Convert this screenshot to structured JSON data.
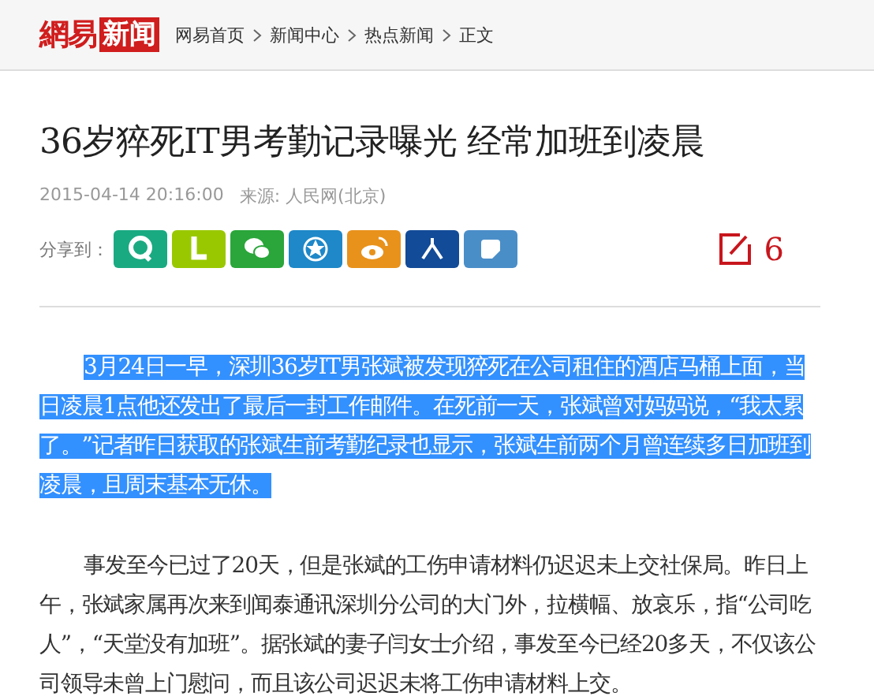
{
  "header": {
    "logo": {
      "text": "網易",
      "badge": "新闻"
    },
    "breadcrumb": [
      {
        "label": "网易首页"
      },
      {
        "label": "新闻中心"
      },
      {
        "label": "热点新闻"
      },
      {
        "label": "正文"
      }
    ]
  },
  "article": {
    "title": "36岁猝死IT男考勤记录曝光 经常加班到凌晨",
    "date": "2015-04-14 20:16:00",
    "source": "来源: 人民网(北京)",
    "share": {
      "label": "分享到：",
      "buttons": [
        {
          "kind": "qq",
          "color": "#1aaa82"
        },
        {
          "kind": "l",
          "color": "#99c800"
        },
        {
          "kind": "wechat",
          "color": "#2aa63a"
        },
        {
          "kind": "star",
          "color": "#1e88c8"
        },
        {
          "kind": "weibo",
          "color": "#e8921c"
        },
        {
          "kind": "person",
          "color": "#124b97"
        },
        {
          "kind": "note",
          "color": "#4a8ec8"
        }
      ]
    },
    "comments": {
      "count": "6"
    },
    "paragraphs": [
      {
        "text": "3月24日一早，深圳36岁IT男张斌被发现猝死在公司租住的酒店马桶上面，当日凌晨1点他还发出了最后一封工作邮件。在死前一天，张斌曾对妈妈说，“我太累了。”记者昨日获取的张斌生前考勤纪录也显示，张斌生前两个月曾连续多日加班到凌晨，且周末基本无休。",
        "selected": true
      },
      {
        "text": "事发至今已过了20天，但是张斌的工伤申请材料仍迟迟未上交社保局。昨日上午，张斌家属再次来到闻泰通讯深圳分公司的大门外，拉横幅、放哀乐，指“公司吃人”，“天堂没有加班”。据张斌的妻子闫女士介绍，事发至今已经20多天，不仅该公司领导未曾上门慰问，而且该公司迟迟未将工伤申请材料上交。",
        "selected": false
      }
    ]
  }
}
